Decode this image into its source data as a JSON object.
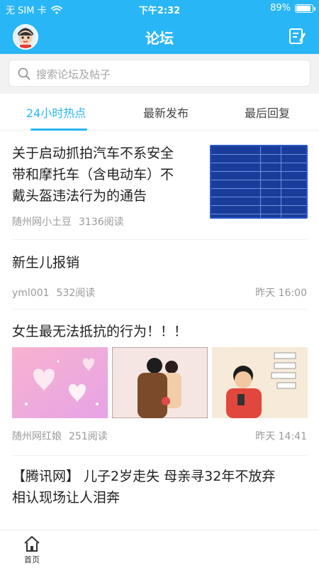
{
  "status_bar": {
    "carrier": "无 SIM 卡",
    "time": "下午2:32",
    "battery": "89%",
    "battery_level": 0.89
  },
  "header": {
    "title": "论坛",
    "avatar_icon": "avatar-icon",
    "compose_icon": "compose-icon"
  },
  "search": {
    "placeholder": "搜索论坛及帖子"
  },
  "tabs": [
    {
      "label": "24小时热点",
      "active": true
    },
    {
      "label": "最新发布",
      "active": false
    },
    {
      "label": "最后回复",
      "active": false
    }
  ],
  "posts": [
    {
      "title_lines": [
        "关于启动抓拍汽车不系安全",
        "带和摩托车（含电动车）不",
        "戴头盔违法行为的通告"
      ],
      "author": "随州网小土豆",
      "reads": "3136阅读",
      "time": ""
    },
    {
      "title_lines": [
        "新生儿报销"
      ],
      "author": "yml001",
      "reads": "532阅读",
      "time": "昨天 16:00"
    },
    {
      "title_lines": [
        "女生最无法抵抗的行为！！！"
      ],
      "author": "随州网红娘",
      "reads": "251阅读",
      "time": "昨天 14:41"
    },
    {
      "title_lines": [
        "【腾讯网】 儿子2岁走失 母亲寻32年不放弃",
        "相认现场让人泪奔"
      ],
      "author": "",
      "reads": "",
      "time": ""
    }
  ],
  "bottom_nav": {
    "home_label": "首页"
  },
  "colors": {
    "brand": "#29b6f6",
    "text": "#222222",
    "muted": "#999999"
  }
}
